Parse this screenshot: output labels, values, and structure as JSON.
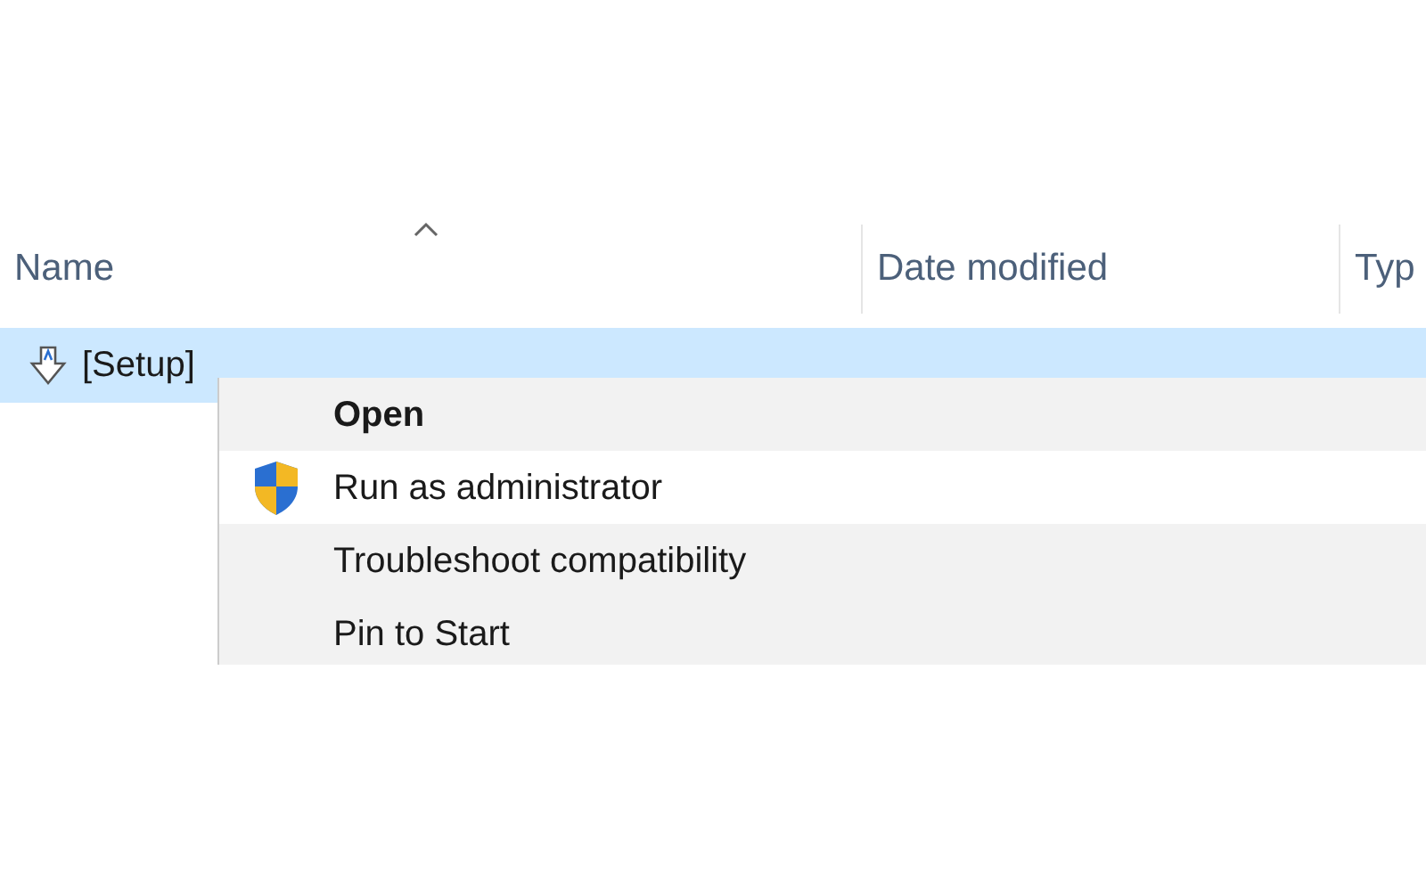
{
  "columns": [
    {
      "label": "Name",
      "sorted": true
    },
    {
      "label": "Date modified",
      "sorted": false
    },
    {
      "label": "Typ",
      "sorted": false
    }
  ],
  "file": {
    "name": "[Setup]",
    "selected": true
  },
  "menu": [
    {
      "label": "Open",
      "default": true,
      "selected": false,
      "kind": "plain"
    },
    {
      "label": "Run as administrator",
      "default": false,
      "selected": true,
      "kind": "elevated"
    },
    {
      "label": "Troubleshoot compatibility",
      "default": false,
      "selected": false,
      "kind": "plain"
    },
    {
      "label": "Pin to Start",
      "default": false,
      "selected": false,
      "kind": "plain"
    }
  ]
}
